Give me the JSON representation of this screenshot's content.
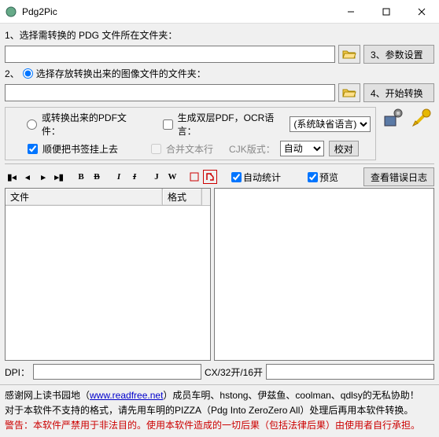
{
  "window": {
    "title": "Pdg2Pic"
  },
  "labels": {
    "step1": "1、选择需转换的 PDG 文件所在文件夹：",
    "step2_prefix": "2、",
    "step2": "选择存放转换出来的图像文件的文件夹：",
    "btn_params": "3、参数设置",
    "btn_start": "4、开始转换"
  },
  "panel": {
    "or_pdf": "或转换出来的PDF文件：",
    "bookmark": "顺便把书签挂上去",
    "gen_dual": "生成双层PDF，OCR语言：",
    "merge_text": "合并文本行",
    "cjk_layout": "CJK版式：",
    "ocr_lang_value": "(系统缺省语言)",
    "cjk_value": "自动",
    "btn_check": "校对"
  },
  "toolbar": {
    "auto_stat": "自动统计",
    "preview": "预览",
    "error_log": "查看错误日志"
  },
  "table": {
    "col_file": "文件",
    "col_format": "格式"
  },
  "dpi": {
    "label": "DPI：",
    "suffix": "CX/32开/16开"
  },
  "footer": {
    "line1a": "感谢网上读书园地（",
    "link": "www.readfree.net",
    "line1b": "）成员车明、hstong、伊兹鱼、coolman、qdlsy的无私协助！",
    "line2": "对于本软件不支持的格式，请先用车明的PIZZA（Pdg Into ZeroZero All）处理后再用本软件转换。",
    "line3": "警告：本软件严禁用于非法目的。使用本软件造成的一切后果（包括法律后果）由使用者自行承担。"
  }
}
